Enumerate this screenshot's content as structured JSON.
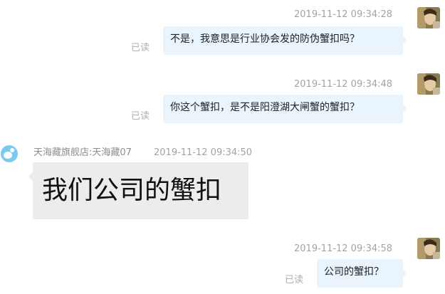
{
  "messages": [
    {
      "sender": "self",
      "timestamp": "2019-11-12 09:34:28",
      "text": "不是，我意思是行业协会发的防伪蟹扣吗？",
      "status": "已读"
    },
    {
      "sender": "self",
      "timestamp": "2019-11-12 09:34:48",
      "text": "你这个蟹扣，是不是阳澄湖大闸蟹的蟹扣？",
      "status": "已读"
    },
    {
      "sender": "shop",
      "name": "天海藏旗舰店:天海藏07",
      "timestamp": "2019-11-12 09:34:50",
      "text": "我们公司的蟹扣"
    },
    {
      "sender": "self",
      "timestamp": "2019-11-12 09:34:58",
      "text": "公司的蟹扣？",
      "status": "已读"
    }
  ],
  "colors": {
    "outgoing_bubble": "#e9f4fd",
    "incoming_bubble": "#ececec",
    "shop_avatar": "#7ec8ee",
    "timestamp_text": "#a3a3a3"
  },
  "icons": {
    "self_avatar": "user-photo-avatar",
    "shop_avatar": "shop-chat-avatar-icon"
  }
}
